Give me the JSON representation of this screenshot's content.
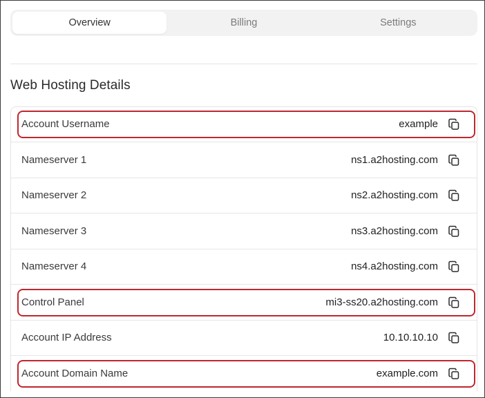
{
  "tabs": [
    {
      "label": "Overview",
      "active": true
    },
    {
      "label": "Billing",
      "active": false
    },
    {
      "label": "Settings",
      "active": false
    }
  ],
  "section": {
    "title": "Web Hosting Details"
  },
  "rows": [
    {
      "label": "Account Username",
      "value": "example",
      "highlighted": true
    },
    {
      "label": "Nameserver 1",
      "value": "ns1.a2hosting.com",
      "highlighted": false
    },
    {
      "label": "Nameserver 2",
      "value": "ns2.a2hosting.com",
      "highlighted": false
    },
    {
      "label": "Nameserver 3",
      "value": "ns3.a2hosting.com",
      "highlighted": false
    },
    {
      "label": "Nameserver 4",
      "value": "ns4.a2hosting.com",
      "highlighted": false
    },
    {
      "label": "Control Panel",
      "value": "mi3-ss20.a2hosting.com",
      "highlighted": true
    },
    {
      "label": "Account IP Address",
      "value": "10.10.10.10",
      "highlighted": false
    },
    {
      "label": "Account Domain Name",
      "value": "example.com",
      "highlighted": true
    }
  ],
  "icons": {
    "copy": "copy-icon"
  },
  "colors": {
    "highlight": "#c0262d",
    "tab_bar_bg": "#f2f2f2"
  }
}
